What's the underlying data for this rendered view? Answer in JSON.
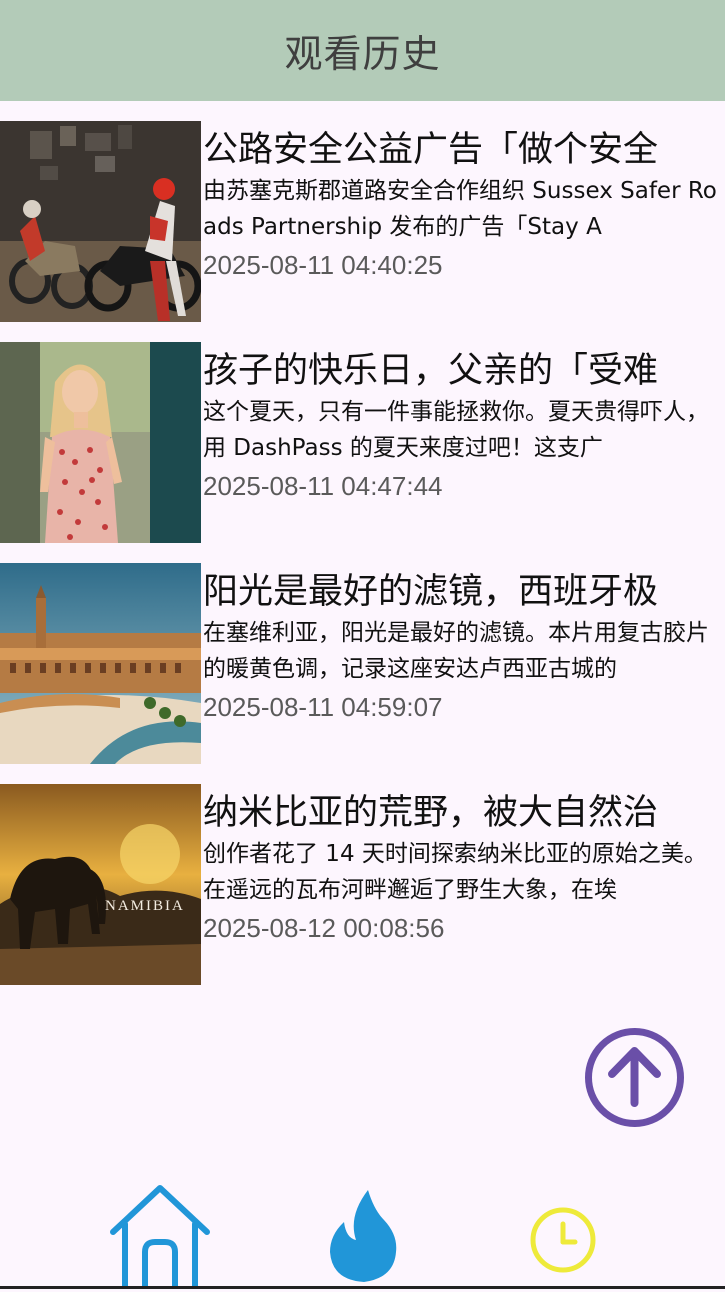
{
  "header": {
    "title": "观看历史"
  },
  "items": [
    {
      "title": "公路安全公益广告「做个安全",
      "desc": "由苏塞克斯郡道路安全合作组织 Sussex Safer Roads Partnership 发布的广告「Stay A",
      "time": "2025-08-11 04:40:25",
      "thumb": "motorcycle-garage-thumbnail"
    },
    {
      "title": "孩子的快乐日，父亲的「受难",
      "desc": "这个夏天，只有一件事能拯救你。夏天贵得吓人，用 DashPass 的夏天来度过吧！这支广",
      "time": "2025-08-11 04:47:44",
      "thumb": "woman-floral-dress-thumbnail"
    },
    {
      "title": "阳光是最好的滤镜，西班牙极",
      "desc": "在塞维利亚，阳光是最好的滤镜。本片用复古胶片的暖黄色调，记录这座安达卢西亚古城的",
      "time": "2025-08-11 04:59:07",
      "thumb": "seville-plaza-thumbnail"
    },
    {
      "title": "纳米比亚的荒野，被大自然治",
      "desc": "创作者花了 14 天时间探索纳米比亚的原始之美。在遥远的瓦布河畔邂逅了野生大象，在埃",
      "time": "2025-08-12 00:08:56",
      "thumb": "namibia-elephant-thumbnail",
      "thumb_caption": "NAMIBIA"
    }
  ],
  "fab": {
    "icon": "arrow-up-circle-icon",
    "color": "#6a4fa8"
  },
  "nav": {
    "home": {
      "icon": "home-icon",
      "color": "#2196d8"
    },
    "hot": {
      "icon": "flame-icon",
      "color": "#2196d8"
    },
    "history": {
      "icon": "clock-icon",
      "color": "#eeea3a"
    }
  }
}
